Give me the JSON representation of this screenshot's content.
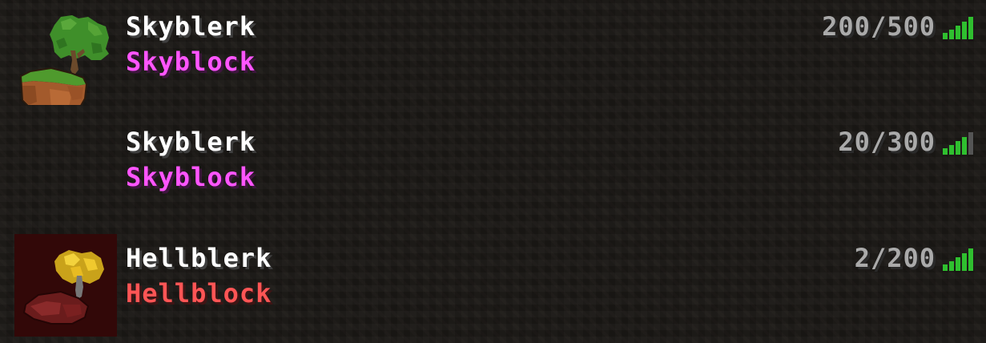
{
  "colors": {
    "name": "#ffffff",
    "skyblock_motd": "#ff55ff",
    "hellblock_motd": "#ff5555",
    "player_count": "#aaaaaa",
    "ping_active": "#55ff55",
    "ping_inactive": "#555555"
  },
  "servers": [
    {
      "name": "Skyblerk",
      "motd": "Skyblock",
      "players": "200/500",
      "icon": "floating-island-tree-icon",
      "ping_bars": 5
    },
    {
      "name": "Skyblerk",
      "motd": "Skyblock",
      "players": "20/300",
      "icon": "none",
      "ping_bars": 4
    },
    {
      "name": "Hellblerk",
      "motd": "Hellblock",
      "players": "2/200",
      "icon": "nether-island-tree-icon",
      "ping_bars": 5
    }
  ]
}
